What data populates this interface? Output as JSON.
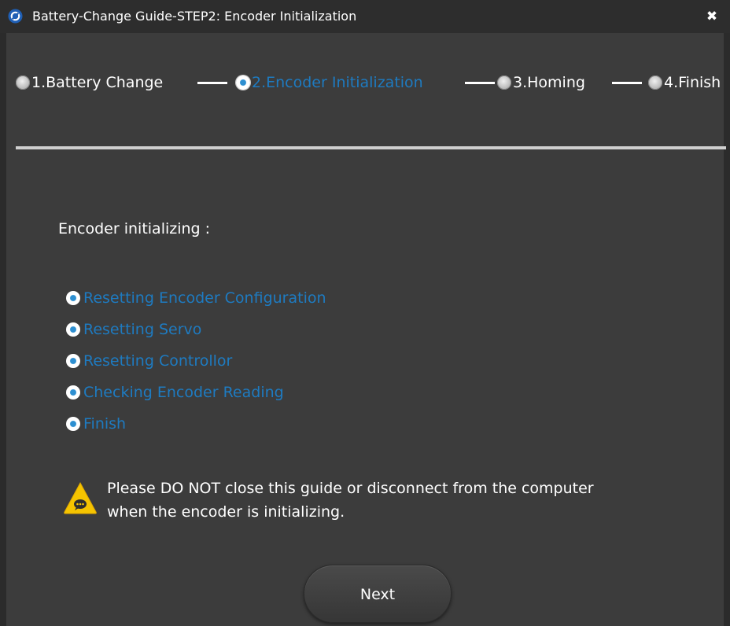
{
  "window": {
    "title": "Battery-Change Guide-STEP2: Encoder Initialization",
    "close_symbol": "✖",
    "app_icon": "app-logo-icon"
  },
  "steps": [
    {
      "label": "1.Battery Change",
      "state": "inactive"
    },
    {
      "label": "2.Encoder Initialization",
      "state": "active"
    },
    {
      "label": "3.Homing",
      "state": "inactive"
    },
    {
      "label": "4.Finish",
      "state": "inactive"
    }
  ],
  "section_heading": "Encoder initializing :",
  "tasks": [
    {
      "label": "Resetting Encoder Configuration"
    },
    {
      "label": "Resetting Servo"
    },
    {
      "label": "Resetting Controllor"
    },
    {
      "label": "Checking Encoder Reading"
    },
    {
      "label": "Finish"
    }
  ],
  "warning": {
    "icon": "warning-triangle-icon",
    "line1": "Please DO NOT close this guide or disconnect from the computer",
    "line2": " when the encoder is initializing."
  },
  "buttons": {
    "next_label": "Next"
  },
  "colors": {
    "background": "#3c3c3c",
    "titlebar": "#2d2d2d",
    "accent": "#1e7bc1",
    "text": "#ffffff",
    "warning_yellow": "#f5c400"
  }
}
